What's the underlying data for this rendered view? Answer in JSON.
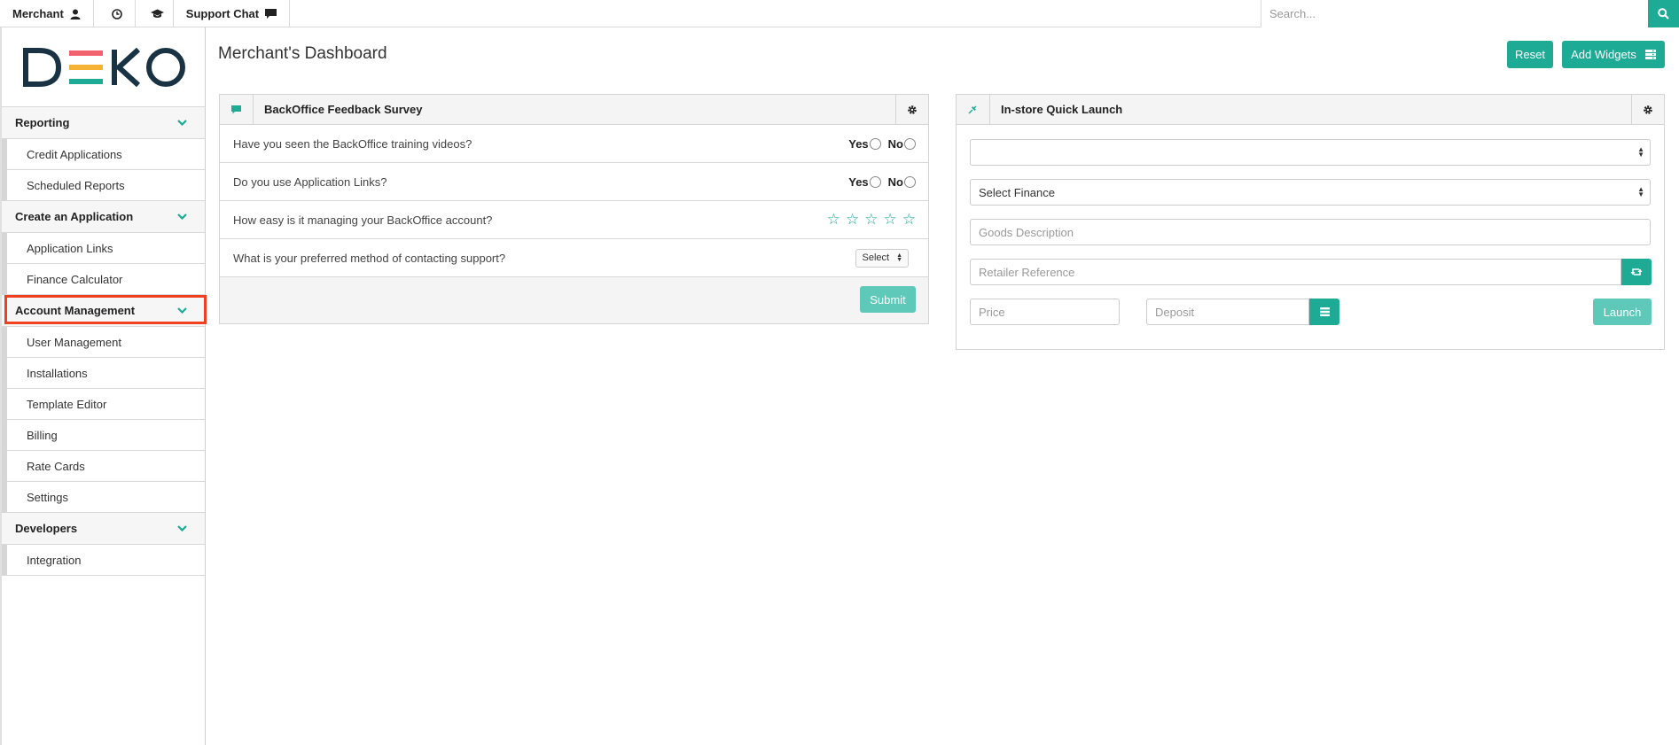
{
  "topbar": {
    "merchant_label": "Merchant",
    "support_chat_label": "Support Chat",
    "search_placeholder": "Search..."
  },
  "sidebar": {
    "logo_text": "DEKO",
    "sections": [
      {
        "label": "Reporting",
        "items": [
          "Credit Applications",
          "Scheduled Reports"
        ]
      },
      {
        "label": "Create an Application",
        "items": [
          "Application Links",
          "Finance Calculator"
        ]
      },
      {
        "label": "Account Management",
        "items": [
          "User Management",
          "Installations",
          "Template Editor",
          "Billing",
          "Rate Cards",
          "Settings"
        ]
      },
      {
        "label": "Developers",
        "items": [
          "Integration"
        ]
      }
    ],
    "highlighted_item": "Finance Calculator"
  },
  "main": {
    "title": "Merchant's Dashboard",
    "reset_label": "Reset",
    "add_widgets_label": "Add Widgets"
  },
  "survey": {
    "title": "BackOffice Feedback Survey",
    "questions": [
      "Have you seen the BackOffice training videos?",
      "Do you use Application Links?",
      "How easy is it managing your BackOffice account?",
      "What is your preferred method of contacting support?"
    ],
    "yes_label": "Yes",
    "no_label": "No",
    "rating_max": 5,
    "contact_select_value": "Select",
    "submit_label": "Submit"
  },
  "quick_launch": {
    "title": "In-store Quick Launch",
    "first_select_value": "",
    "finance_select_value": "Select Finance",
    "goods_placeholder": "Goods Description",
    "retailer_placeholder": "Retailer Reference",
    "price_placeholder": "Price",
    "deposit_placeholder": "Deposit",
    "launch_label": "Launch"
  },
  "colors": {
    "accent": "#1dab96",
    "accent_light": "#5ec9b8",
    "highlight_border": "#f04020"
  }
}
